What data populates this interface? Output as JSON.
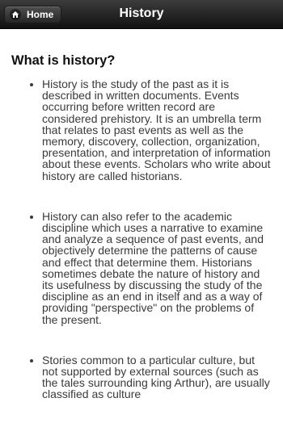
{
  "header": {
    "home_label": "Home",
    "title": "History"
  },
  "content": {
    "heading": "What is history?",
    "paragraphs": [
      "History is the study of the past as it is described in written documents. Events occurring before written record are considered prehistory. It is an umbrella term that relates to past events as well as the memory, discovery, collection, organization, presentation, and interpretation of information about these events. Scholars who write about history are called historians.",
      "History can also refer to the academic discipline which uses a narrative to examine and analyze a sequence of past events, and objectively determine the patterns of cause and effect that determine them. Historians sometimes debate the nature of history and its usefulness by discussing the study of the discipline as an end in itself and as a way of providing \"perspective\" on the problems of the present.",
      "Stories common to a particular culture, but not supported by external sources (such as the tales surrounding king Arthur), are usually classified as culture"
    ]
  }
}
